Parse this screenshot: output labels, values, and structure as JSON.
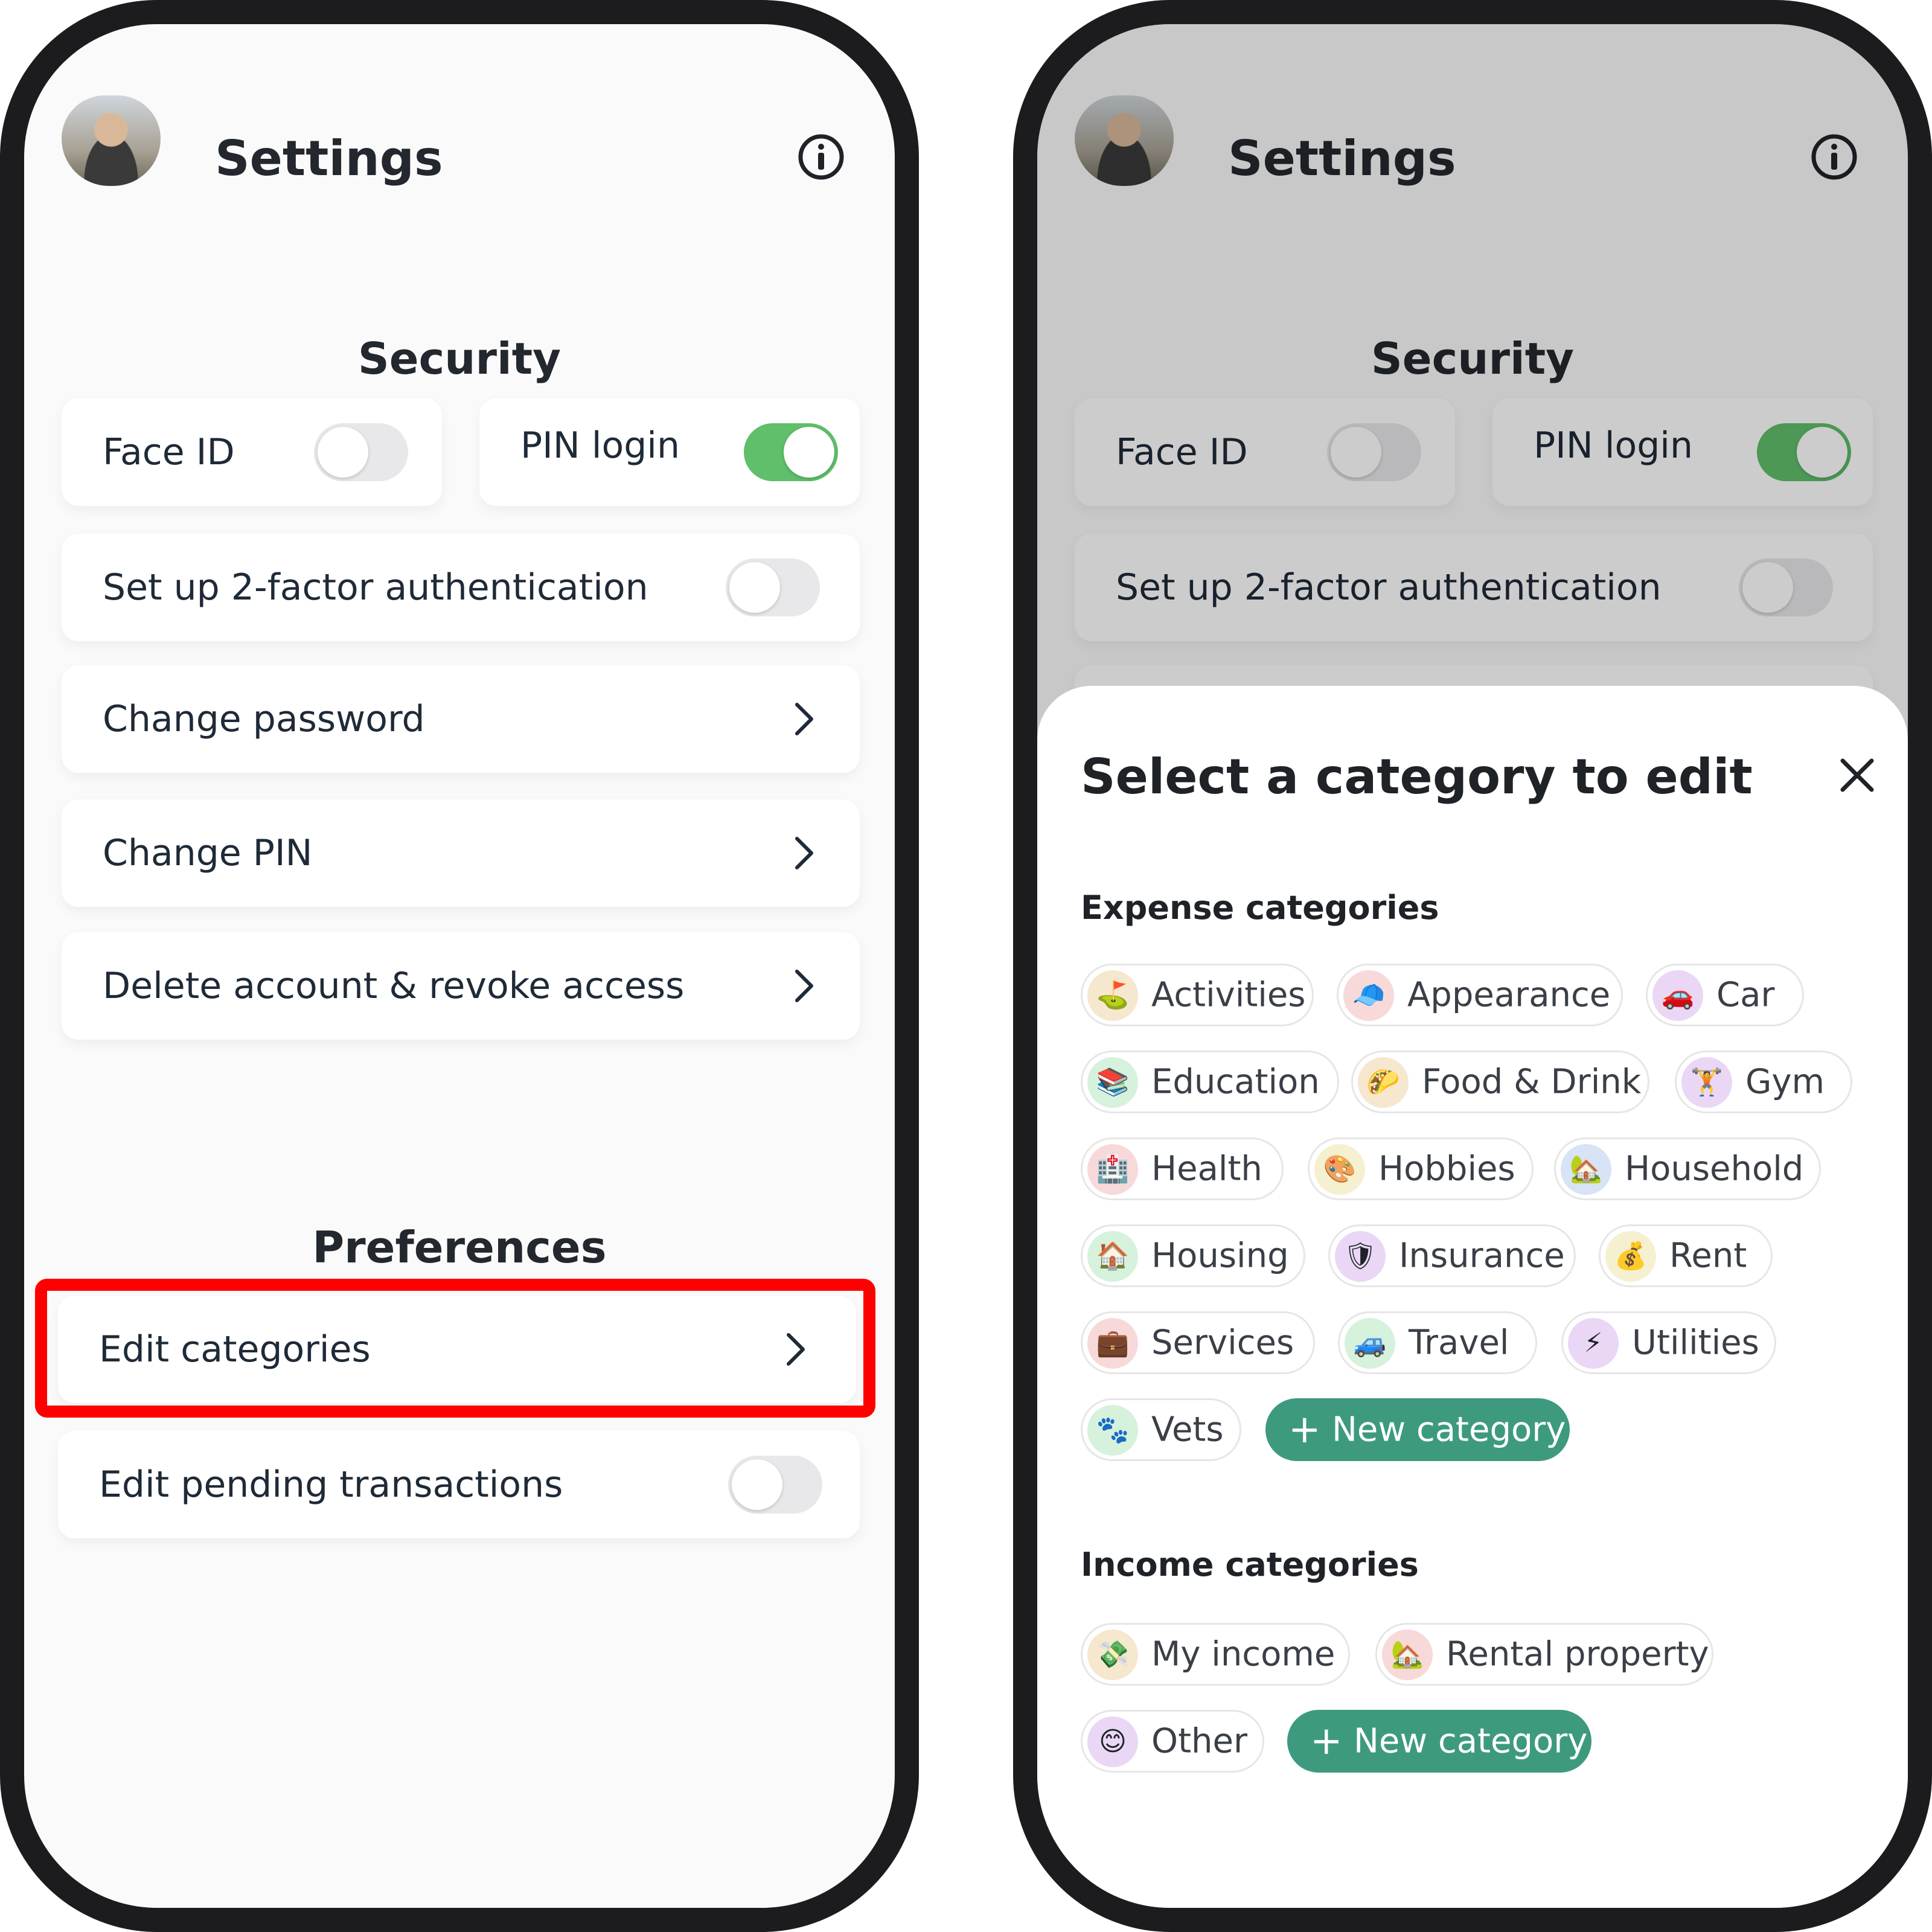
{
  "header": {
    "title": "Settings"
  },
  "security": {
    "title": "Security",
    "face_id": {
      "label": "Face ID",
      "enabled": false
    },
    "pin_login": {
      "label": "PIN login",
      "enabled": true
    },
    "two_factor": {
      "label": "Set up 2-factor authentication",
      "enabled": false
    },
    "change_password": {
      "label": "Change password"
    },
    "change_pin": {
      "label": "Change PIN"
    },
    "delete_account": {
      "label": "Delete account & revoke access"
    }
  },
  "preferences": {
    "title": "Preferences",
    "edit_categories": {
      "label": "Edit categories"
    },
    "edit_pending": {
      "label": "Edit pending transactions",
      "enabled": false
    }
  },
  "sheet": {
    "title": "Select a category to edit",
    "expense_title": "Expense categories",
    "income_title": "Income categories",
    "expense": [
      {
        "label": "Activities",
        "emoji": "⛳",
        "color": "#f6e7cf"
      },
      {
        "label": "Appearance",
        "emoji": "🧢",
        "color": "#f8d9d9"
      },
      {
        "label": "Car",
        "emoji": "🚗",
        "color": "#ead7f6"
      },
      {
        "label": "Education",
        "emoji": "📚",
        "color": "#d6f1dc"
      },
      {
        "label": "Food & Drink",
        "emoji": "🌮",
        "color": "#f6e7cf"
      },
      {
        "label": "Gym",
        "emoji": "🏋",
        "color": "#ead7f6"
      },
      {
        "label": "Health",
        "emoji": "🏥",
        "color": "#f8d9d9"
      },
      {
        "label": "Hobbies",
        "emoji": "🎨",
        "color": "#f5f0cf"
      },
      {
        "label": "Household",
        "emoji": "🏡",
        "color": "#d9e3f6"
      },
      {
        "label": "Housing",
        "emoji": "🏠",
        "color": "#d6f1dc"
      },
      {
        "label": "Insurance",
        "emoji": "🛡",
        "color": "#ead7f6"
      },
      {
        "label": "Rent",
        "emoji": "💰",
        "color": "#f5f0cf"
      },
      {
        "label": "Services",
        "emoji": "💼",
        "color": "#f8d9d9"
      },
      {
        "label": "Travel",
        "emoji": "🚙",
        "color": "#d6f1dc"
      },
      {
        "label": "Utilities",
        "emoji": "⚡",
        "color": "#ead7f6"
      },
      {
        "label": "Vets",
        "emoji": "🐾",
        "color": "#d6f1dc"
      }
    ],
    "income": [
      {
        "label": "My income",
        "emoji": "💸",
        "color": "#f6e7cf"
      },
      {
        "label": "Rental property",
        "emoji": "🏡",
        "color": "#f8d9d9"
      },
      {
        "label": "Other",
        "emoji": "😊",
        "color": "#ead7f6"
      }
    ],
    "new_category_label": "New category",
    "new_category_icon": "+"
  },
  "colors": {
    "toggle_on": "#5fbf6a",
    "accent_button": "#3e9a7e",
    "highlight": "#ff0000"
  }
}
